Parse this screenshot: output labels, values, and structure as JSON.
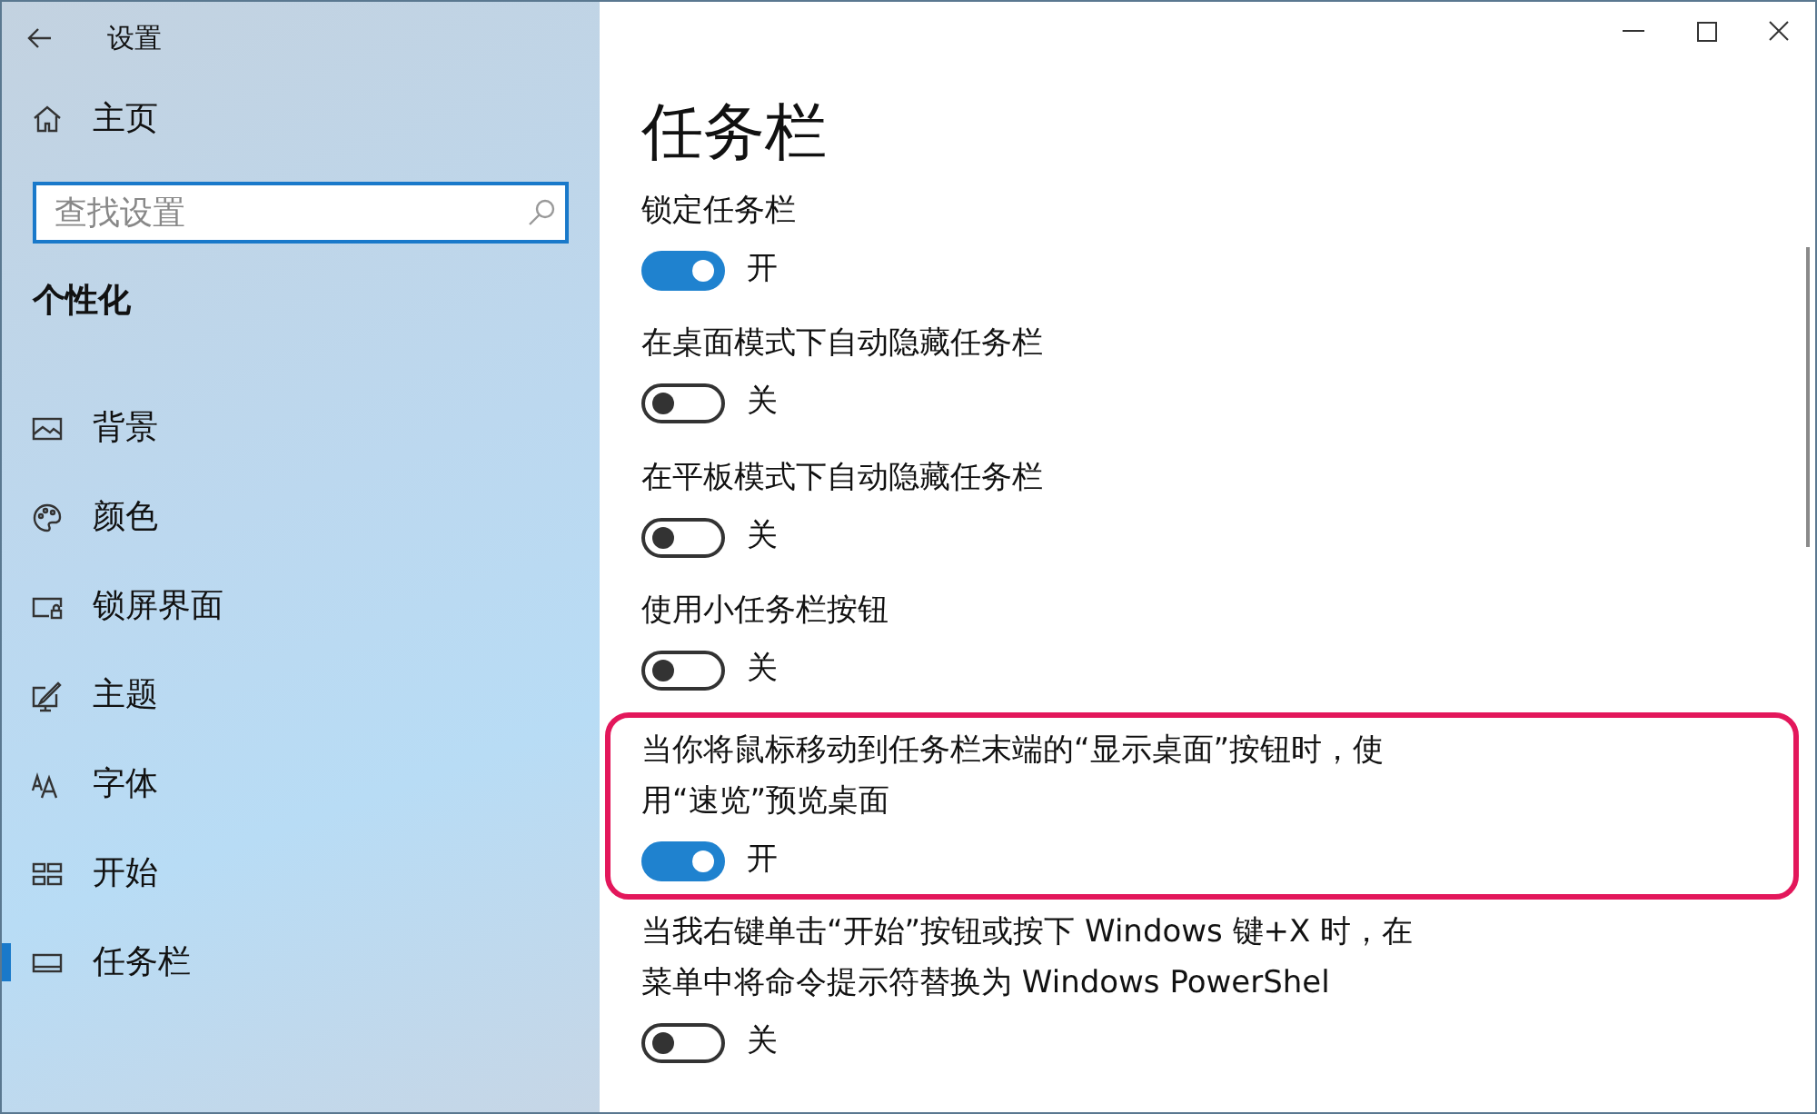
{
  "window": {
    "title": "设置"
  },
  "sidebar": {
    "home": "主页",
    "search": {
      "placeholder": "查找设置"
    },
    "section": "个性化",
    "items": [
      {
        "label": "背景",
        "kind": "picture",
        "selected": false
      },
      {
        "label": "颜色",
        "kind": "palette",
        "selected": false
      },
      {
        "label": "锁屏界面",
        "kind": "lockscreen",
        "selected": false
      },
      {
        "label": "主题",
        "kind": "theme",
        "selected": false
      },
      {
        "label": "字体",
        "kind": "font",
        "selected": false
      },
      {
        "label": "开始",
        "kind": "start",
        "selected": false
      },
      {
        "label": "任务栏",
        "kind": "taskbar",
        "selected": true
      }
    ]
  },
  "page": {
    "title": "任务栏",
    "settings": [
      {
        "label": "锁定任务栏",
        "on": true,
        "state": "开",
        "highlighted": false
      },
      {
        "label": "在桌面模式下自动隐藏任务栏",
        "on": false,
        "state": "关",
        "highlighted": false
      },
      {
        "label": "在平板模式下自动隐藏任务栏",
        "on": false,
        "state": "关",
        "highlighted": false
      },
      {
        "label": "使用小任务栏按钮",
        "on": false,
        "state": "关",
        "highlighted": false
      },
      {
        "label": "当你将鼠标移动到任务栏末端的“显示桌面”按钮时，使用“速览”预览桌面",
        "on": true,
        "state": "开",
        "highlighted": true
      },
      {
        "label": "当我右键单击“开始”按钮或按下 Windows 键+X 时，在菜单中将命令提示符替换为 Windows PowerShel",
        "on": false,
        "state": "关",
        "highlighted": false
      }
    ]
  }
}
